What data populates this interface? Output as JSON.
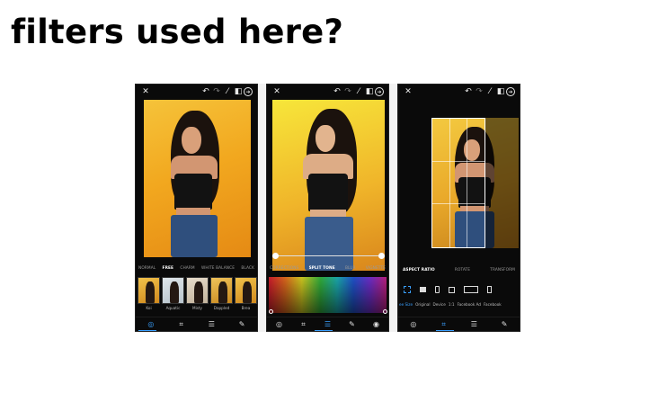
{
  "heading": "filters used here?",
  "screens": [
    {
      "tabs": [
        "NORMAL",
        "FREE",
        "CHARM",
        "WHITE BALANCE",
        "BLACK"
      ],
      "active_tab": 1,
      "thumbnails": [
        "Koi",
        "Aquatic",
        "Misty",
        "Dappled",
        "Brea"
      ]
    },
    {
      "tabs": [
        "CORRECTIONS",
        "SPLIT TONE",
        "BLUR",
        "VIGNETTE"
      ],
      "active_tab": 1
    },
    {
      "tabs": [
        "ASPECT RATIO",
        "ROTATE",
        "TRANSFORM"
      ],
      "active_tab": 0,
      "ratio_options": [
        "ee Size",
        "Original",
        "Device",
        "1:1",
        "Facebook Ad",
        "Facebook"
      ]
    }
  ],
  "icons": {
    "close": "close-icon",
    "undo": "undo-icon",
    "redo": "redo-icon",
    "magic_wand": "magic-wand-icon",
    "compare": "compare-icon",
    "next": "next-arrow-icon"
  },
  "colors": {
    "accent": "#3aa0ff",
    "phone_bg": "#0a0a0a"
  }
}
